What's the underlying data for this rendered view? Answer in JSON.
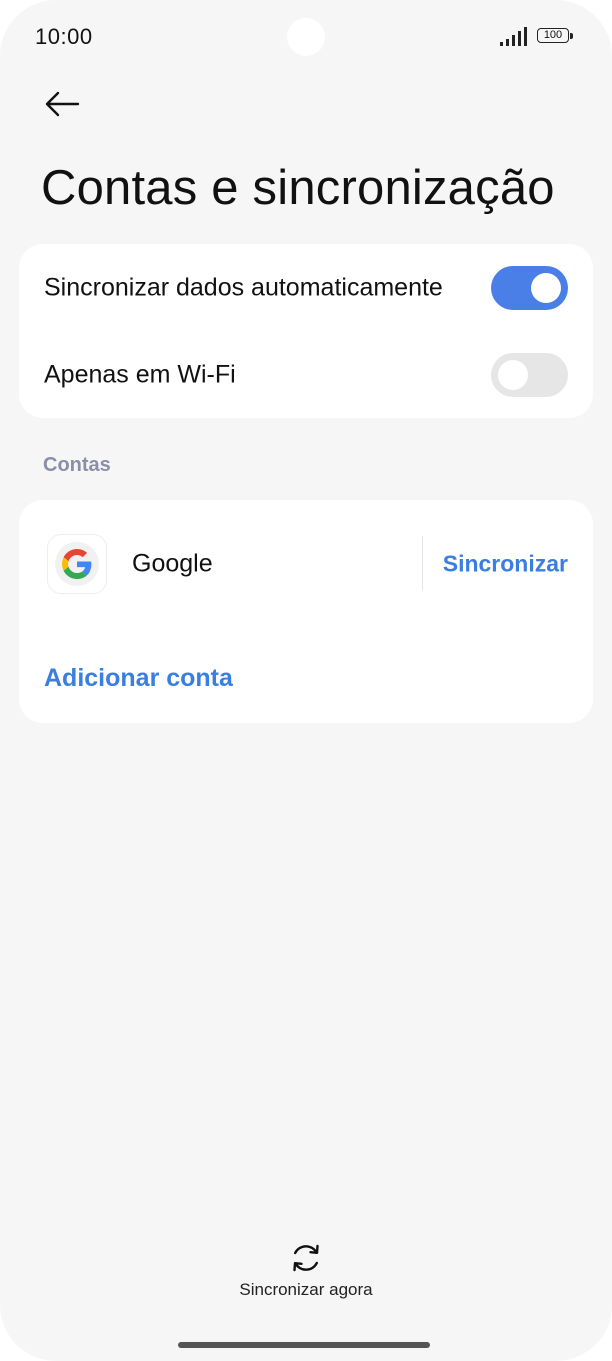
{
  "status_bar": {
    "time": "10:00",
    "battery_level": "100",
    "signal_icon": "signal-bars-icon"
  },
  "header": {
    "back_icon": "arrow-left-icon",
    "title": "Contas e sincronização"
  },
  "sync_settings": {
    "items": [
      {
        "label": "Sincronizar dados automaticamente",
        "enabled": true
      },
      {
        "label": "Apenas em Wi-Fi",
        "enabled": false
      }
    ]
  },
  "accounts": {
    "section_label": "Contas",
    "items": [
      {
        "name": "Google",
        "icon": "google-logo-icon",
        "action": "Sincronizar"
      }
    ],
    "add_label": "Adicionar conta"
  },
  "footer": {
    "sync_now_label": "Sincronizar agora",
    "sync_now_icon": "sync-icon"
  },
  "colors": {
    "background": "#f6f6f6",
    "card": "#ffffff",
    "accent": "#3a7ee0",
    "toggle_on": "#4a7fe8",
    "toggle_off": "#e6e6e6",
    "section_label": "#8a8fa8"
  }
}
